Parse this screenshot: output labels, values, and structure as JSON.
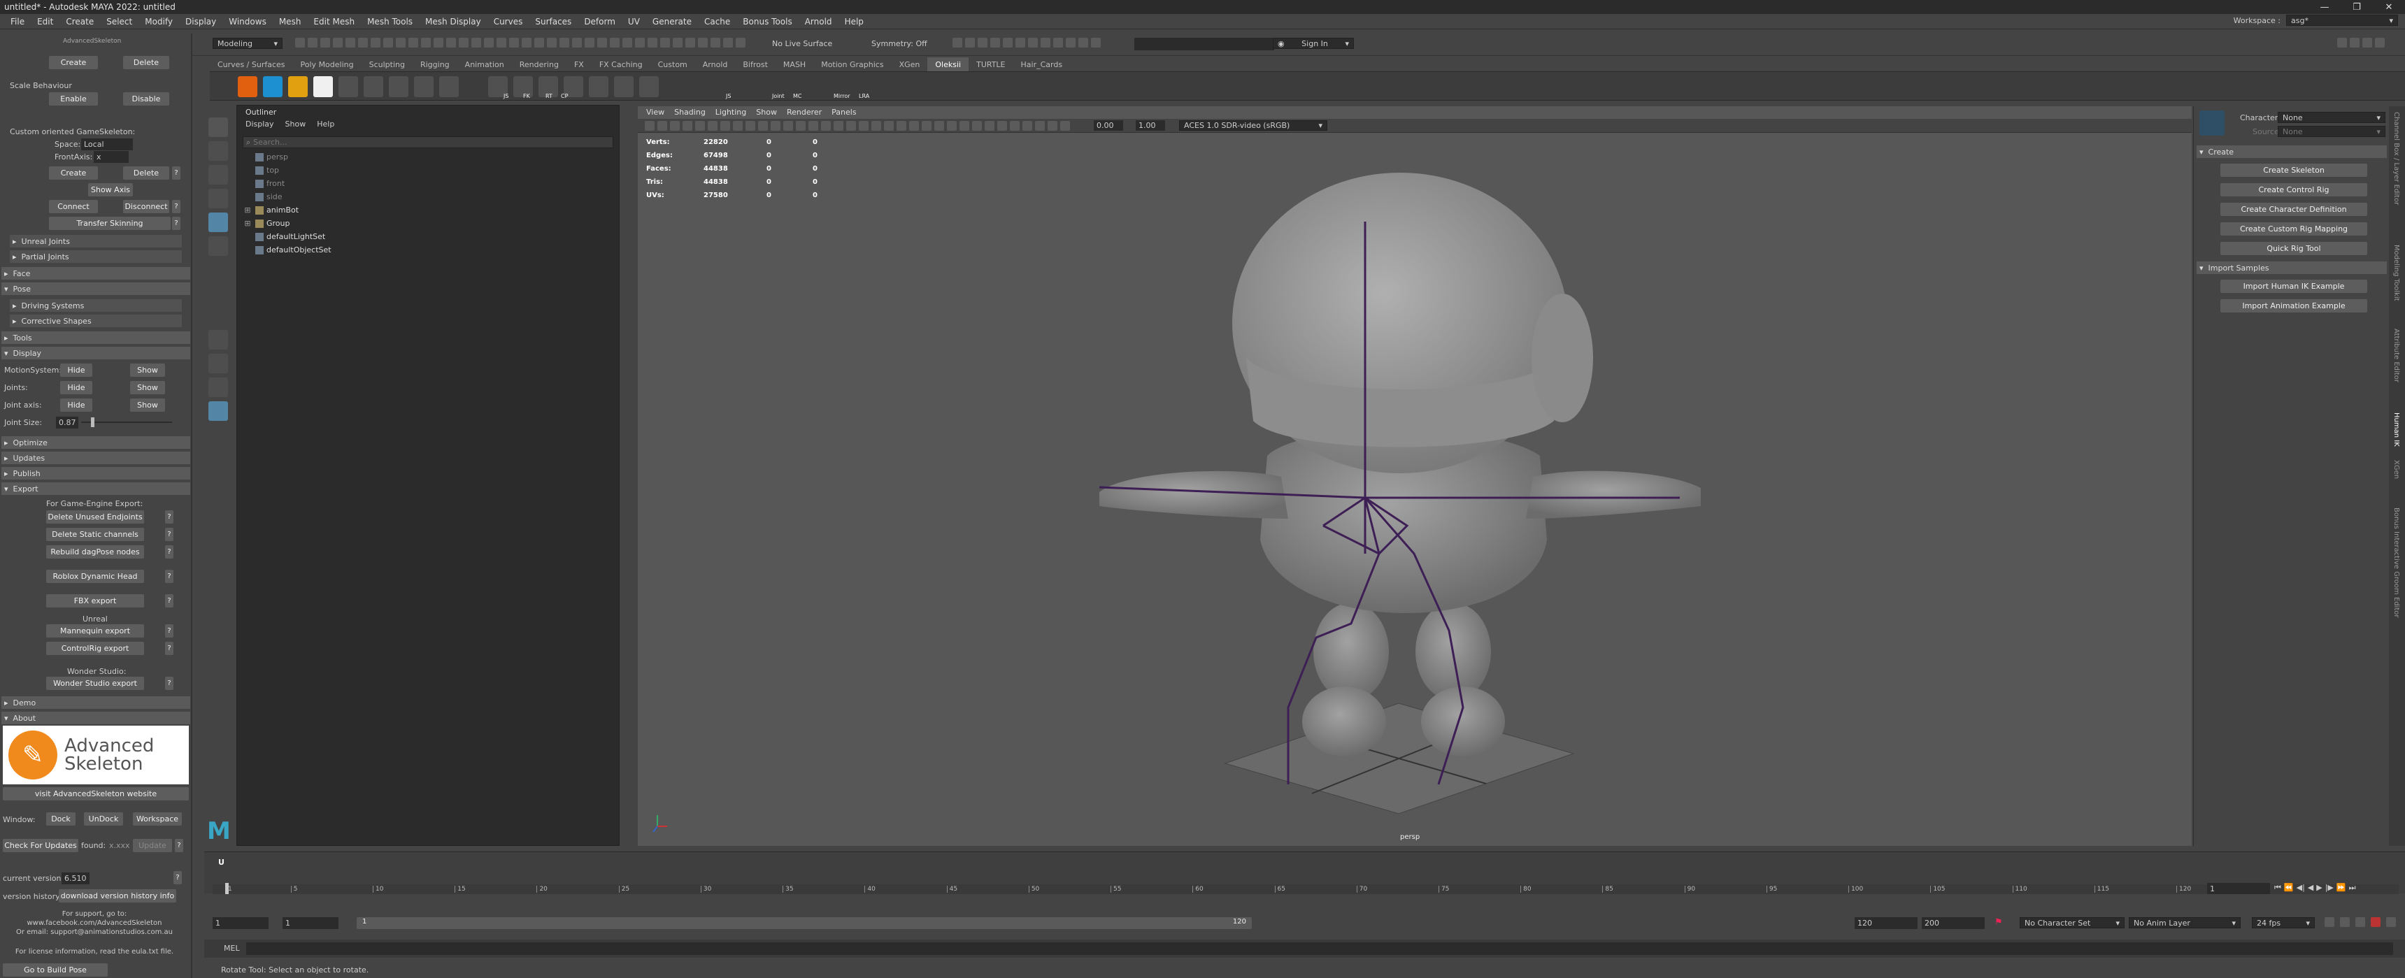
{
  "window": {
    "title": "untitled* - Autodesk MAYA 2022: untitled",
    "controls": [
      "—",
      "❐",
      "✕"
    ]
  },
  "menubar": [
    "File",
    "Edit",
    "Create",
    "Select",
    "Modify",
    "Display",
    "Windows",
    "Mesh",
    "Edit Mesh",
    "Mesh Tools",
    "Mesh Display",
    "Curves",
    "Surfaces",
    "Deform",
    "UV",
    "Generate",
    "Cache",
    "Bonus Tools",
    "Arnold",
    "Help"
  ],
  "workspace": {
    "label": "Workspace :",
    "value": "asg*"
  },
  "statusline": {
    "mode": "Modeling",
    "live_surface": "No Live Surface",
    "symmetry": "Symmetry: Off",
    "sign_in": "Sign In"
  },
  "shelf_tabs": [
    "Curves / Surfaces",
    "Poly Modeling",
    "Sculpting",
    "Rigging",
    "Animation",
    "Rendering",
    "FX",
    "FX Caching",
    "Custom",
    "Arnold",
    "Bifrost",
    "MASH",
    "Motion Graphics",
    "XGen",
    "Oleksii",
    "TURTLE",
    "Hair_Cards"
  ],
  "shelf_active_tab": "Oleksii",
  "shelf_labels": [
    "JS",
    "FK",
    "RT",
    "CP",
    "JS",
    "Joint",
    "MC",
    "Mirror",
    "LRA"
  ],
  "left_panel": {
    "title": "AdvancedSkeleton",
    "top_buttons": {
      "create": "Create",
      "delete": "Delete"
    },
    "scale_behaviour": {
      "label": "Scale Behaviour",
      "enable": "Enable",
      "disable": "Disable"
    },
    "game_skeleton": {
      "label": "Custom oriented GameSkeleton:",
      "space_label": "Space:",
      "space_value": "Local",
      "front_axis_label": "FrontAxis:",
      "front_axis_value": "x",
      "create": "Create",
      "delete": "Delete",
      "show_axis": "Show Axis",
      "connect": "Connect",
      "disconnect": "Disconnect",
      "transfer": "Transfer Skinning"
    },
    "subsections": [
      "Unreal Joints",
      "Partial Joints"
    ],
    "sections": {
      "face": "Face",
      "pose": "Pose",
      "tools": "Tools",
      "display": "Display",
      "optimize": "Optimize",
      "updates": "Updates",
      "publish": "Publish",
      "export": "Export",
      "demo": "Demo",
      "about": "About"
    },
    "pose_subsections": [
      "Driving Systems",
      "Corrective Shapes"
    ],
    "display_rows": [
      {
        "label": "MotionSystem:",
        "hide": "Hide",
        "show": "Show"
      },
      {
        "label": "Joints:",
        "hide": "Hide",
        "show": "Show"
      },
      {
        "label": "Joint axis:",
        "hide": "Hide",
        "show": "Show"
      }
    ],
    "joint_size": {
      "label": "Joint Size:",
      "value": "0.87"
    },
    "export": {
      "game_engine_label": "For Game-Engine Export:",
      "buttons1": [
        "Delete Unused Endjoints",
        "Delete Static channels",
        "Rebuild dagPose nodes"
      ],
      "roblox": "Roblox Dynamic Head",
      "fbx": "FBX export",
      "unreal_label": "Unreal",
      "unreal_buttons": [
        "Mannequin export",
        "ControlRig export"
      ],
      "wonder_label": "Wonder Studio:",
      "wonder_button": "Wonder Studio export"
    },
    "about": {
      "logo_line1": "Advanced",
      "logo_line2": "Skeleton",
      "website_button": "visit AdvancedSkeleton website",
      "window_label": "Window:",
      "dock": "Dock",
      "undock": "UnDock",
      "workspace": "Workspace",
      "check_updates": "Check For Updates",
      "found": "found:",
      "found_value": "x.xxx",
      "update": "Update",
      "current_version_label": "current version:",
      "current_version": "6.510",
      "version_history_label": "version history:",
      "version_history_button": "download version history info",
      "support_lines": [
        "For support, go to:",
        "www.facebook.com/AdvancedSkeleton",
        "Or email: support@animationstudios.com.au"
      ],
      "license": "For license information, read the eula.txt file.",
      "pose_button": "Go to Build Pose"
    }
  },
  "outliner": {
    "title": "Outliner",
    "menu": [
      "Display",
      "Show",
      "Help"
    ],
    "search_placeholder": "Search...",
    "items": [
      {
        "name": "persp",
        "dim": true,
        "expand": false
      },
      {
        "name": "top",
        "dim": true,
        "expand": false
      },
      {
        "name": "front",
        "dim": true,
        "expand": false
      },
      {
        "name": "side",
        "dim": true,
        "expand": false
      },
      {
        "name": "animBot",
        "dim": false,
        "expand": true
      },
      {
        "name": "Group",
        "dim": false,
        "expand": true
      },
      {
        "name": "defaultLightSet",
        "dim": false,
        "expand": false
      },
      {
        "name": "defaultObjectSet",
        "dim": false,
        "expand": false
      }
    ]
  },
  "viewport": {
    "menu": [
      "View",
      "Shading",
      "Lighting",
      "Show",
      "Renderer",
      "Panels"
    ],
    "hud": [
      {
        "label": "Verts:",
        "a": "22820",
        "b": "0",
        "c": "0"
      },
      {
        "label": "Edges:",
        "a": "67498",
        "b": "0",
        "c": "0"
      },
      {
        "label": "Faces:",
        "a": "44838",
        "b": "0",
        "c": "0"
      },
      {
        "label": "Tris:",
        "a": "44838",
        "b": "0",
        "c": "0"
      },
      {
        "label": "UVs:",
        "a": "27580",
        "b": "0",
        "c": "0"
      }
    ],
    "camera": "persp",
    "exposure": "0.00",
    "gamma": "1.00",
    "color_space": "ACES 1.0 SDR-video (sRGB)"
  },
  "right_panel": {
    "character_label": "Character:",
    "character_value": "None",
    "source_label": "Source:",
    "source_value": "None",
    "create_header": "Create",
    "create_buttons": [
      "Create Skeleton",
      "Create Control Rig",
      "Create Character Definition",
      "Create Custom Rig Mapping",
      "Quick Rig Tool"
    ],
    "import_header": "Import Samples",
    "import_buttons": [
      "Import Human IK Example",
      "Import Animation Example"
    ]
  },
  "side_tabs": [
    "Channel Box / Layer Editor",
    "Modeling Toolkit",
    "Attribute Editor",
    "Human IK",
    "XGen",
    "Bonus Interactive Groom Editor"
  ],
  "time_slider": {
    "ticks": [
      "1",
      "5",
      "10",
      "15",
      "20",
      "25",
      "30",
      "35",
      "40",
      "45",
      "50",
      "55",
      "60",
      "65",
      "70",
      "75",
      "80",
      "85",
      "90",
      "95",
      "100",
      "105",
      "110",
      "115",
      "120"
    ],
    "current_frame": "1",
    "frame_field": "1"
  },
  "range": {
    "start": "1",
    "start2": "1",
    "playback_start": "1",
    "playback_end": "120",
    "end": "120",
    "end2": "200",
    "character_set": "No Character Set",
    "anim_layer": "No Anim Layer",
    "fps": "24 fps"
  },
  "mel": {
    "label": "MEL"
  },
  "help_line": "Rotate Tool: Select an object to rotate."
}
